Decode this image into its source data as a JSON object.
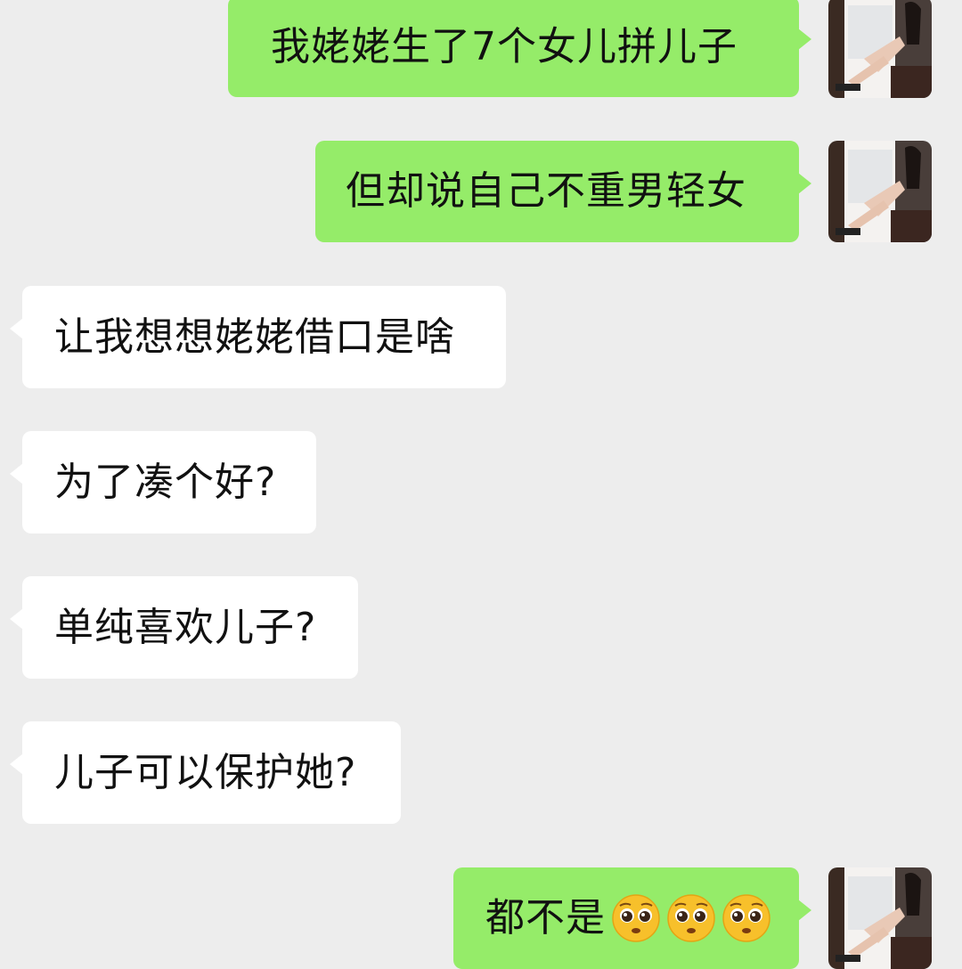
{
  "messages": [
    {
      "side": "me",
      "text": "我姥姥生了7个女儿拼儿子"
    },
    {
      "side": "me",
      "text": "但却说自己不重男轻女"
    },
    {
      "side": "them",
      "text": "让我想想姥姥借口是啥"
    },
    {
      "side": "them",
      "text": "为了凑个好?"
    },
    {
      "side": "them",
      "text": "单纯喜欢儿子?"
    },
    {
      "side": "them",
      "text": "儿子可以保护她?"
    },
    {
      "side": "me",
      "text": "都不是",
      "emojis": [
        "pleading-face-icon",
        "pleading-face-icon",
        "pleading-face-icon"
      ]
    }
  ],
  "colors": {
    "background": "#ededed",
    "me_bubble": "#95ec69",
    "them_bubble": "#ffffff"
  }
}
